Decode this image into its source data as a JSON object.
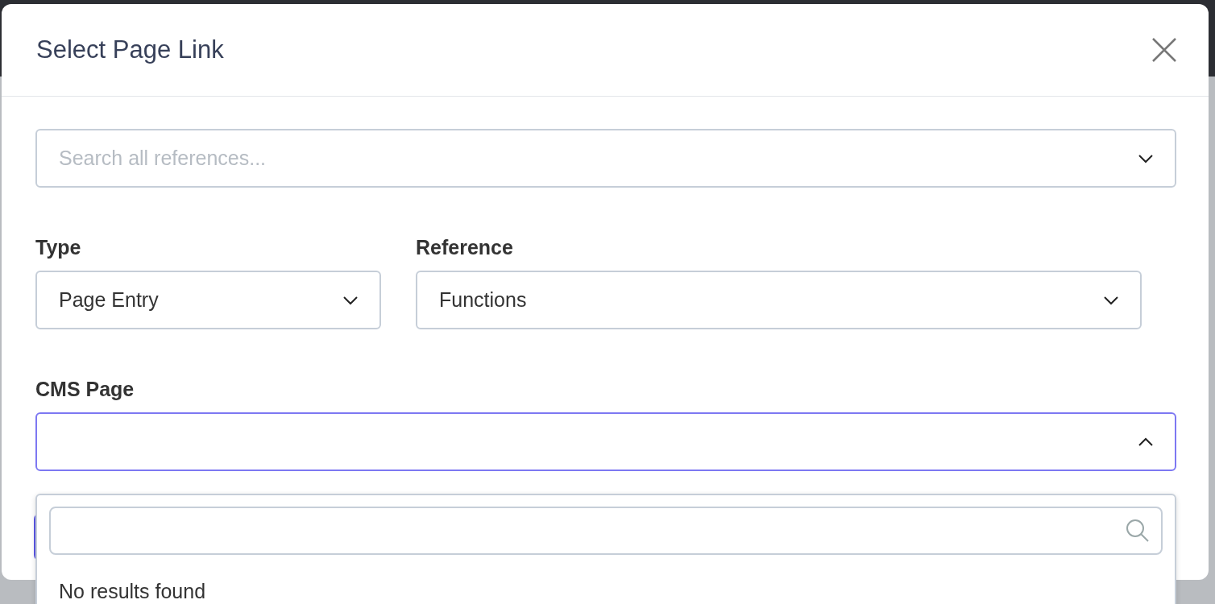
{
  "dialog": {
    "title": "Select Page Link"
  },
  "search": {
    "placeholder": "Search all references..."
  },
  "fields": [
    {
      "label": "Type",
      "value": "Page Entry"
    },
    {
      "label": "Reference",
      "value": "Functions"
    }
  ],
  "cms_page": {
    "label": "CMS Page",
    "expanded": true,
    "no_results": "No results found"
  }
}
